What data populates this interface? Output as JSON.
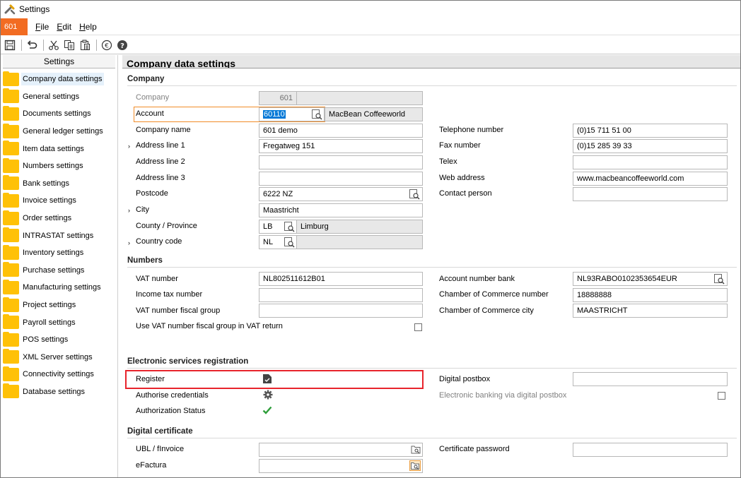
{
  "window": {
    "title": "Settings"
  },
  "menubar": {
    "company_badge": "601",
    "menus": [
      "File",
      "Edit",
      "Help"
    ]
  },
  "toolbar": {
    "icons": [
      "save-icon",
      "undo-icon",
      "cut-icon",
      "copy-icon",
      "paste-icon",
      "euro-icon",
      "help-icon"
    ]
  },
  "sidebar": {
    "header": "Settings",
    "items": [
      "Company data settings",
      "General settings",
      "Documents settings",
      "General ledger settings",
      "Item data settings",
      "Numbers settings",
      "Bank settings",
      "Invoice settings",
      "Order settings",
      "INTRASTAT settings",
      "Inventory settings",
      "Purchase settings",
      "Manufacturing settings",
      "Project settings",
      "Payroll settings",
      "POS settings",
      "XML Server settings",
      "Connectivity settings",
      "Database settings"
    ],
    "active_index": 0
  },
  "main": {
    "title": "Company data settings",
    "company": {
      "section": "Company",
      "company_label": "Company",
      "company_value": "601",
      "account_label": "Account",
      "account_value": "60110",
      "account_name": "MacBean Coffeeworld",
      "company_name_label": "Company name",
      "company_name_value": "601 demo",
      "address1_label": "Address line 1",
      "address1_value": "Fregatweg 151",
      "address2_label": "Address line 2",
      "address2_value": "",
      "address3_label": "Address line 3",
      "address3_value": "",
      "postcode_label": "Postcode",
      "postcode_value": "6222 NZ",
      "city_label": "City",
      "city_value": "Maastricht",
      "county_label": "County / Province",
      "county_code": "LB",
      "county_name": "Limburg",
      "country_label": "Country code",
      "country_code": "NL",
      "country_name": "",
      "telephone_label": "Telephone number",
      "telephone_value": "(0)15 711 51 00",
      "fax_label": "Fax number",
      "fax_value": "(0)15 285 39 33",
      "telex_label": "Telex",
      "telex_value": "",
      "web_label": "Web address",
      "web_value": "www.macbeancoffeeworld.com",
      "contact_label": "Contact person",
      "contact_value": ""
    },
    "numbers": {
      "section": "Numbers",
      "vat_label": "VAT number",
      "vat_value": "NL802511612B01",
      "income_tax_label": "Income tax number",
      "income_tax_value": "",
      "vat_fiscal_label": "VAT number fiscal group",
      "vat_fiscal_value": "",
      "use_vat_fiscal_label": "Use VAT number fiscal group in VAT return",
      "use_vat_fiscal_checked": false,
      "bank_label": "Account number bank",
      "bank_value": "NL93RABO0102353654EUR",
      "coc_number_label": "Chamber of Commerce number",
      "coc_number_value": "18888888",
      "coc_city_label": "Chamber of Commerce city",
      "coc_city_value": "MAASTRICHT"
    },
    "electronic": {
      "section": "Electronic services registration",
      "register_label": "Register",
      "authorise_label": "Authorise credentials",
      "status_label": "Authorization Status",
      "digital_postbox_label": "Digital postbox",
      "digital_postbox_value": "",
      "ebanking_label": "Electronic banking via digital postbox",
      "ebanking_checked": false,
      "highlight_color": "#e8242c"
    },
    "certificate": {
      "section": "Digital certificate",
      "ubl_label": "UBL / fInvoice",
      "ubl_value": "",
      "efactura_label": "eFactura",
      "efactura_value": "",
      "cert_password_label": "Certificate password",
      "cert_password_value": ""
    }
  },
  "colors": {
    "accent": "#f26c22",
    "folder": "#ffc107",
    "selection": "#0078d7",
    "check": "#2e9e3a"
  }
}
